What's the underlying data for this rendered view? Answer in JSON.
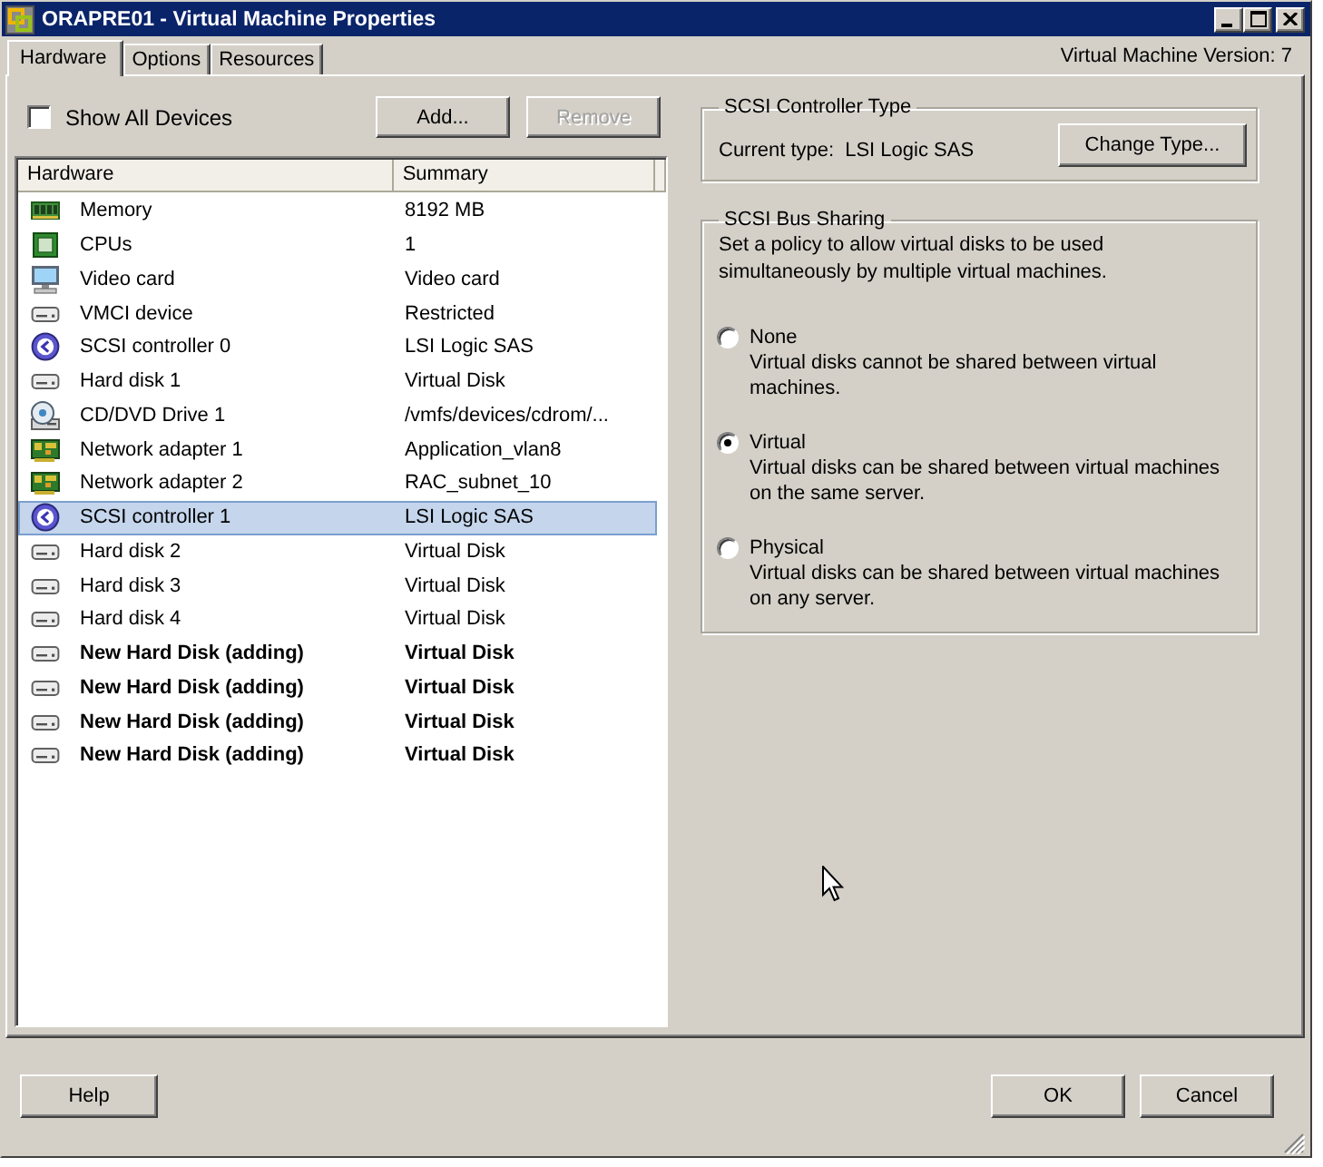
{
  "window": {
    "title": "ORAPRE01 - Virtual Machine Properties"
  },
  "tabs": [
    {
      "label": "Hardware",
      "selected": true
    },
    {
      "label": "Options",
      "selected": false
    },
    {
      "label": "Resources",
      "selected": false
    }
  ],
  "version_label": "Virtual Machine Version: 7",
  "show_all_devices": {
    "label": "Show All Devices",
    "checked": false
  },
  "device_buttons": [
    {
      "label": "Add...",
      "disabled": false
    },
    {
      "label": "Remove",
      "disabled": true
    }
  ],
  "hardware_table": {
    "columns": [
      "Hardware",
      "Summary"
    ],
    "rows": [
      {
        "kind": "memory",
        "name": "Memory",
        "summary": "8192 MB",
        "selected": false,
        "pending": false
      },
      {
        "kind": "cpu",
        "name": "CPUs",
        "summary": "1",
        "selected": false,
        "pending": false
      },
      {
        "kind": "video",
        "name": "Video card",
        "summary": "Video card",
        "selected": false,
        "pending": false
      },
      {
        "kind": "device",
        "name": "VMCI device",
        "summary": "Restricted",
        "selected": false,
        "pending": false
      },
      {
        "kind": "scsi",
        "name": "SCSI controller 0",
        "summary": "LSI Logic SAS",
        "selected": false,
        "pending": false
      },
      {
        "kind": "disk",
        "name": "Hard disk 1",
        "summary": "Virtual Disk",
        "selected": false,
        "pending": false
      },
      {
        "kind": "cdrom",
        "name": "CD/DVD Drive 1",
        "summary": "/vmfs/devices/cdrom/...",
        "selected": false,
        "pending": false
      },
      {
        "kind": "network",
        "name": "Network adapter 1",
        "summary": "Application_vlan8",
        "selected": false,
        "pending": false
      },
      {
        "kind": "network",
        "name": "Network adapter 2",
        "summary": "RAC_subnet_10",
        "selected": false,
        "pending": false
      },
      {
        "kind": "scsi",
        "name": "SCSI controller 1",
        "summary": "LSI Logic SAS",
        "selected": true,
        "pending": false
      },
      {
        "kind": "disk",
        "name": "Hard disk 2",
        "summary": "Virtual Disk",
        "selected": false,
        "pending": false
      },
      {
        "kind": "disk",
        "name": "Hard disk 3",
        "summary": "Virtual Disk",
        "selected": false,
        "pending": false
      },
      {
        "kind": "disk",
        "name": "Hard disk 4",
        "summary": "Virtual Disk",
        "selected": false,
        "pending": false
      },
      {
        "kind": "disk",
        "name": "New Hard Disk (adding)",
        "summary": "Virtual Disk",
        "selected": false,
        "pending": true
      },
      {
        "kind": "disk",
        "name": "New Hard Disk (adding)",
        "summary": "Virtual Disk",
        "selected": false,
        "pending": true
      },
      {
        "kind": "disk",
        "name": "New Hard Disk (adding)",
        "summary": "Virtual Disk",
        "selected": false,
        "pending": true
      },
      {
        "kind": "disk",
        "name": "New Hard Disk (adding)",
        "summary": "Virtual Disk",
        "selected": false,
        "pending": true
      }
    ]
  },
  "controller_type": {
    "title": "SCSI Controller Type",
    "current_label": "Current type:",
    "current_value": "LSI Logic SAS",
    "button": "Change Type..."
  },
  "bus_sharing": {
    "title": "SCSI Bus Sharing",
    "description": "Set a policy to allow virtual disks to be used simultaneously by multiple virtual machines.",
    "options": [
      {
        "label": "None",
        "description": "Virtual disks cannot be shared between virtual machines.",
        "selected": false
      },
      {
        "label": "Virtual",
        "description": "Virtual disks can be shared between virtual machines on the same server.",
        "selected": true
      },
      {
        "label": "Physical",
        "description": "Virtual disks can be shared between virtual machines on any server.",
        "selected": false
      }
    ]
  },
  "help_button": "Help",
  "dialog_buttons": [
    "OK",
    "Cancel"
  ]
}
